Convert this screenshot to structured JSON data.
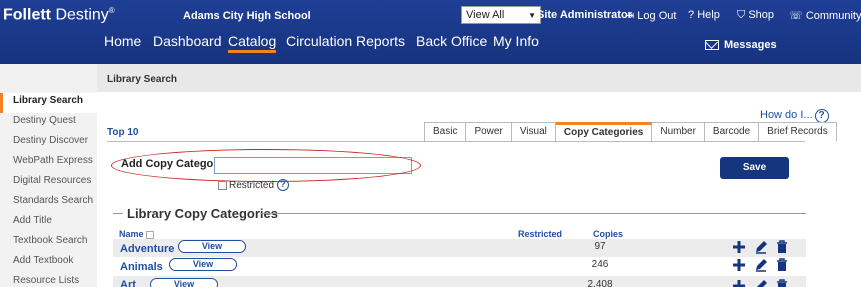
{
  "header": {
    "brand_bold": "Follett",
    "brand_rest": " Destiny",
    "brand_reg": "®",
    "school": "Adams City High School",
    "view_select": "View All",
    "user": "Site Administrator",
    "logout": "Log Out",
    "help": "Help",
    "shop": "Shop",
    "community": "Community",
    "nav": [
      "Home",
      "Dashboard",
      "Catalog",
      "Circulation",
      "Reports",
      "Back Office",
      "My Info"
    ],
    "active_nav": "Catalog",
    "messages": "Messages"
  },
  "breadcrumb": "Library Search",
  "sidebar": {
    "items": [
      {
        "label": "Library Search"
      },
      {
        "label": "Destiny Quest"
      },
      {
        "label": "Destiny Discover"
      },
      {
        "label": "WebPath Express"
      },
      {
        "label": "Digital Resources"
      },
      {
        "label": "Standards Search"
      },
      {
        "label": "Add Title"
      },
      {
        "label": "Textbook Search"
      },
      {
        "label": "Add Textbook"
      },
      {
        "label": "Resource Lists"
      }
    ]
  },
  "main": {
    "how_do_i": "How do I...",
    "top10": "Top 10",
    "tabs": [
      "Basic",
      "Power",
      "Visual",
      "Copy Categories",
      "Number",
      "Barcode",
      "Brief Records"
    ],
    "active_tab": "Copy Categories",
    "add_label": "Add Copy Category",
    "add_value": "",
    "restricted_label": "Restricted",
    "save": "Save",
    "section_title": "Library Copy Categories",
    "columns": {
      "name": "Name",
      "restricted": "Restricted",
      "copies": "Copies"
    },
    "rows": [
      {
        "name": "Adventure",
        "view": "View",
        "copies": "97"
      },
      {
        "name": "Animals",
        "view": "View",
        "copies": "246"
      },
      {
        "name": "Art",
        "view": "View",
        "copies": "2,408"
      }
    ]
  },
  "colors": {
    "header_bg": "#1a3a8a",
    "accent": "#f58220",
    "link": "#1f4fa0",
    "highlight_ellipse": "#cc2222"
  }
}
